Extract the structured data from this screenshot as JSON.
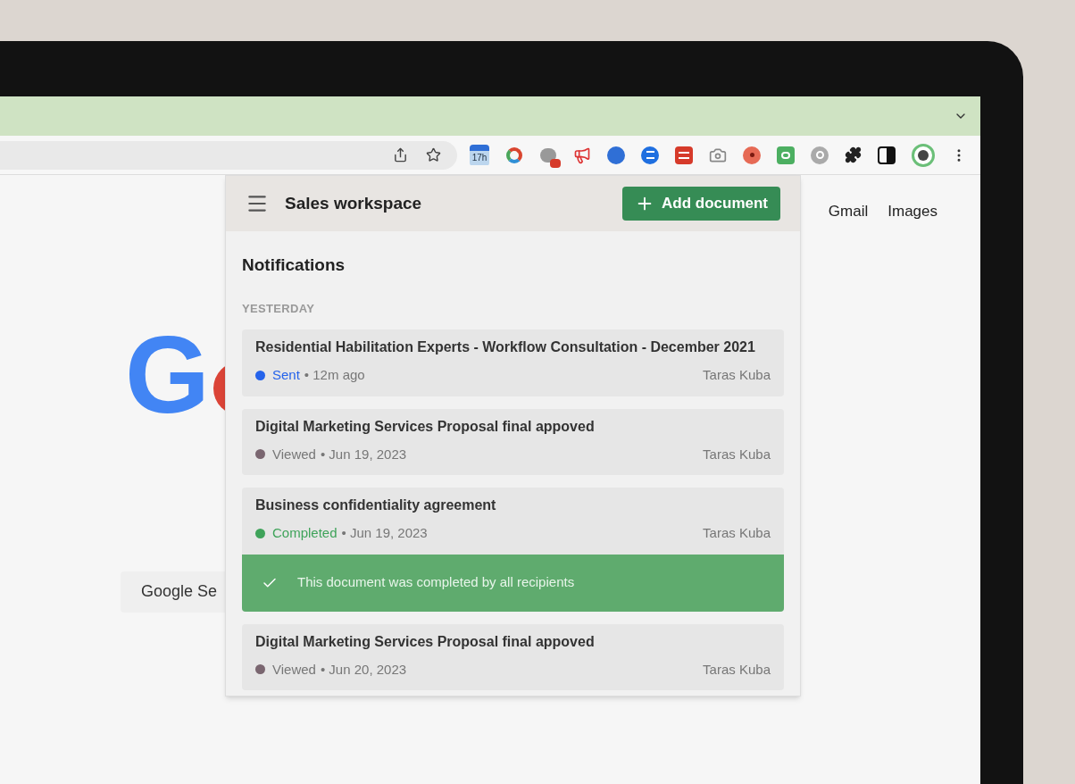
{
  "toolbar": {
    "calendar_badge": "17h"
  },
  "page": {
    "logo_letter": "G",
    "search_button": "Google Se",
    "links": [
      "Gmail",
      "Images"
    ]
  },
  "popup": {
    "title": "Sales workspace",
    "add_button": "Add document",
    "heading": "Notifications",
    "section": "YESTERDAY",
    "items": [
      {
        "title": "Residential Habilitation Experts - Workflow Consultation - December 2021",
        "status": "Sent",
        "color": "#2563eb",
        "date": "• 12m ago",
        "author": "Taras Kuba"
      },
      {
        "title": "Digital Marketing Services Proposal final appoved",
        "status": "Viewed",
        "color": "#7a6670",
        "date": "• Jun 19, 2023",
        "author": "Taras Kuba"
      },
      {
        "title": "Business confidentiality agreement",
        "status": "Completed",
        "color": "#3fa35a",
        "date": "• Jun 19, 2023",
        "author": "Taras Kuba",
        "banner": "This document was completed by all recipients"
      },
      {
        "title": "Digital Marketing Services Proposal final appoved",
        "status": "Viewed",
        "color": "#7a6670",
        "date": "• Jun 20, 2023",
        "author": "Taras Kuba"
      }
    ]
  }
}
